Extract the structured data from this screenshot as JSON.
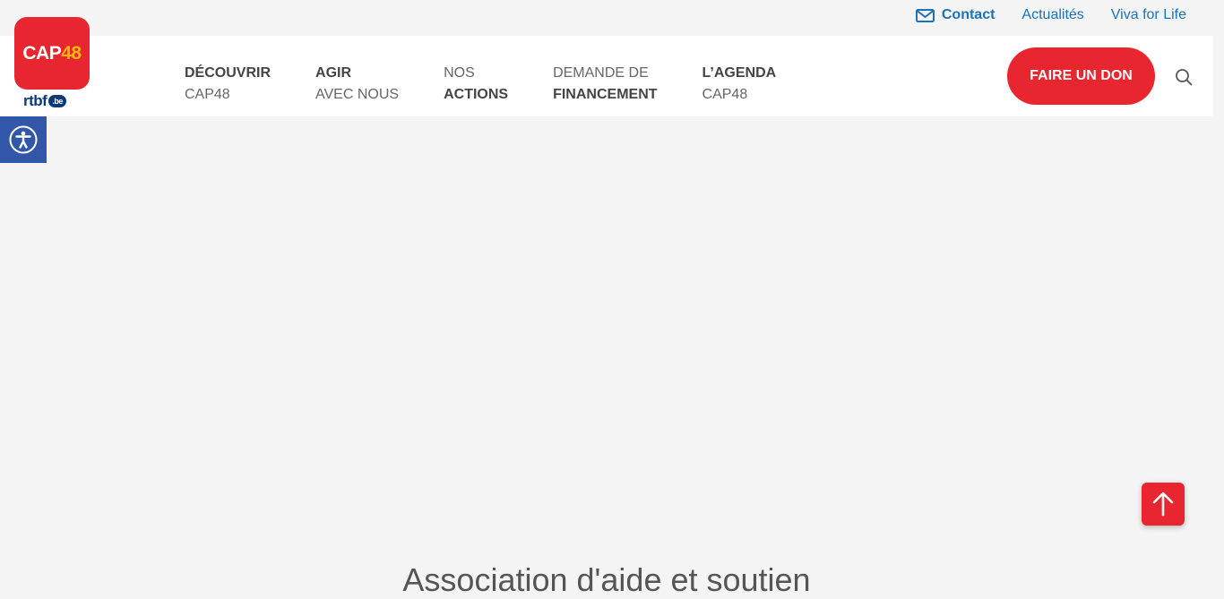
{
  "topbar": {
    "links": [
      {
        "label": "Contact",
        "icon": "mail-icon"
      },
      {
        "label": "Actualités"
      },
      {
        "label": "Viva for Life"
      }
    ]
  },
  "logo": {
    "name_a": "CAP",
    "name_b": "48",
    "sub": "rtbf",
    "sub_badge": ".be"
  },
  "menu": {
    "items": [
      {
        "line1": "DÉCOUVRIR",
        "line2": "CAP48"
      },
      {
        "line1": "AGIR",
        "line2": "AVEC NOUS"
      },
      {
        "line1": "NOS",
        "line2": "ACTIONS"
      },
      {
        "line1": "DEMANDE DE",
        "line2": "FINANCEMENT"
      },
      {
        "line1": "L’AGENDA",
        "line2": "CAP48"
      }
    ]
  },
  "donate": {
    "label": "FAIRE UN DON"
  },
  "hero": {
    "title": "Association d'aide et soutien"
  },
  "colors": {
    "brand_red": "#e8262f",
    "link_blue": "#1a73b8",
    "a11y_blue": "#3257a8",
    "logo_yellow": "#ffb800"
  }
}
